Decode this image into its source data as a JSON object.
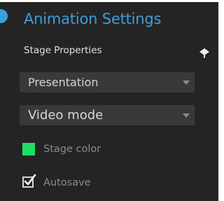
{
  "panel": {
    "title": "Animation Settings",
    "section_label": "Stage Properties"
  },
  "dropdowns": [
    {
      "value": "Presentation"
    },
    {
      "value": "Video mode"
    }
  ],
  "stage_color": {
    "label": "Stage color",
    "color": "#1ee064"
  },
  "autosave": {
    "label": "Autosave",
    "checked": true
  },
  "colors": {
    "accent": "#3c9fd9",
    "panel_background": "#242424",
    "dropdown_background": "#393939"
  },
  "icons": {
    "title": "blue-dot-icon",
    "section_action": "paint-bucket-icon",
    "dropdown": "chevron-down-icon",
    "autosave": "checkbox-checked-icon"
  }
}
